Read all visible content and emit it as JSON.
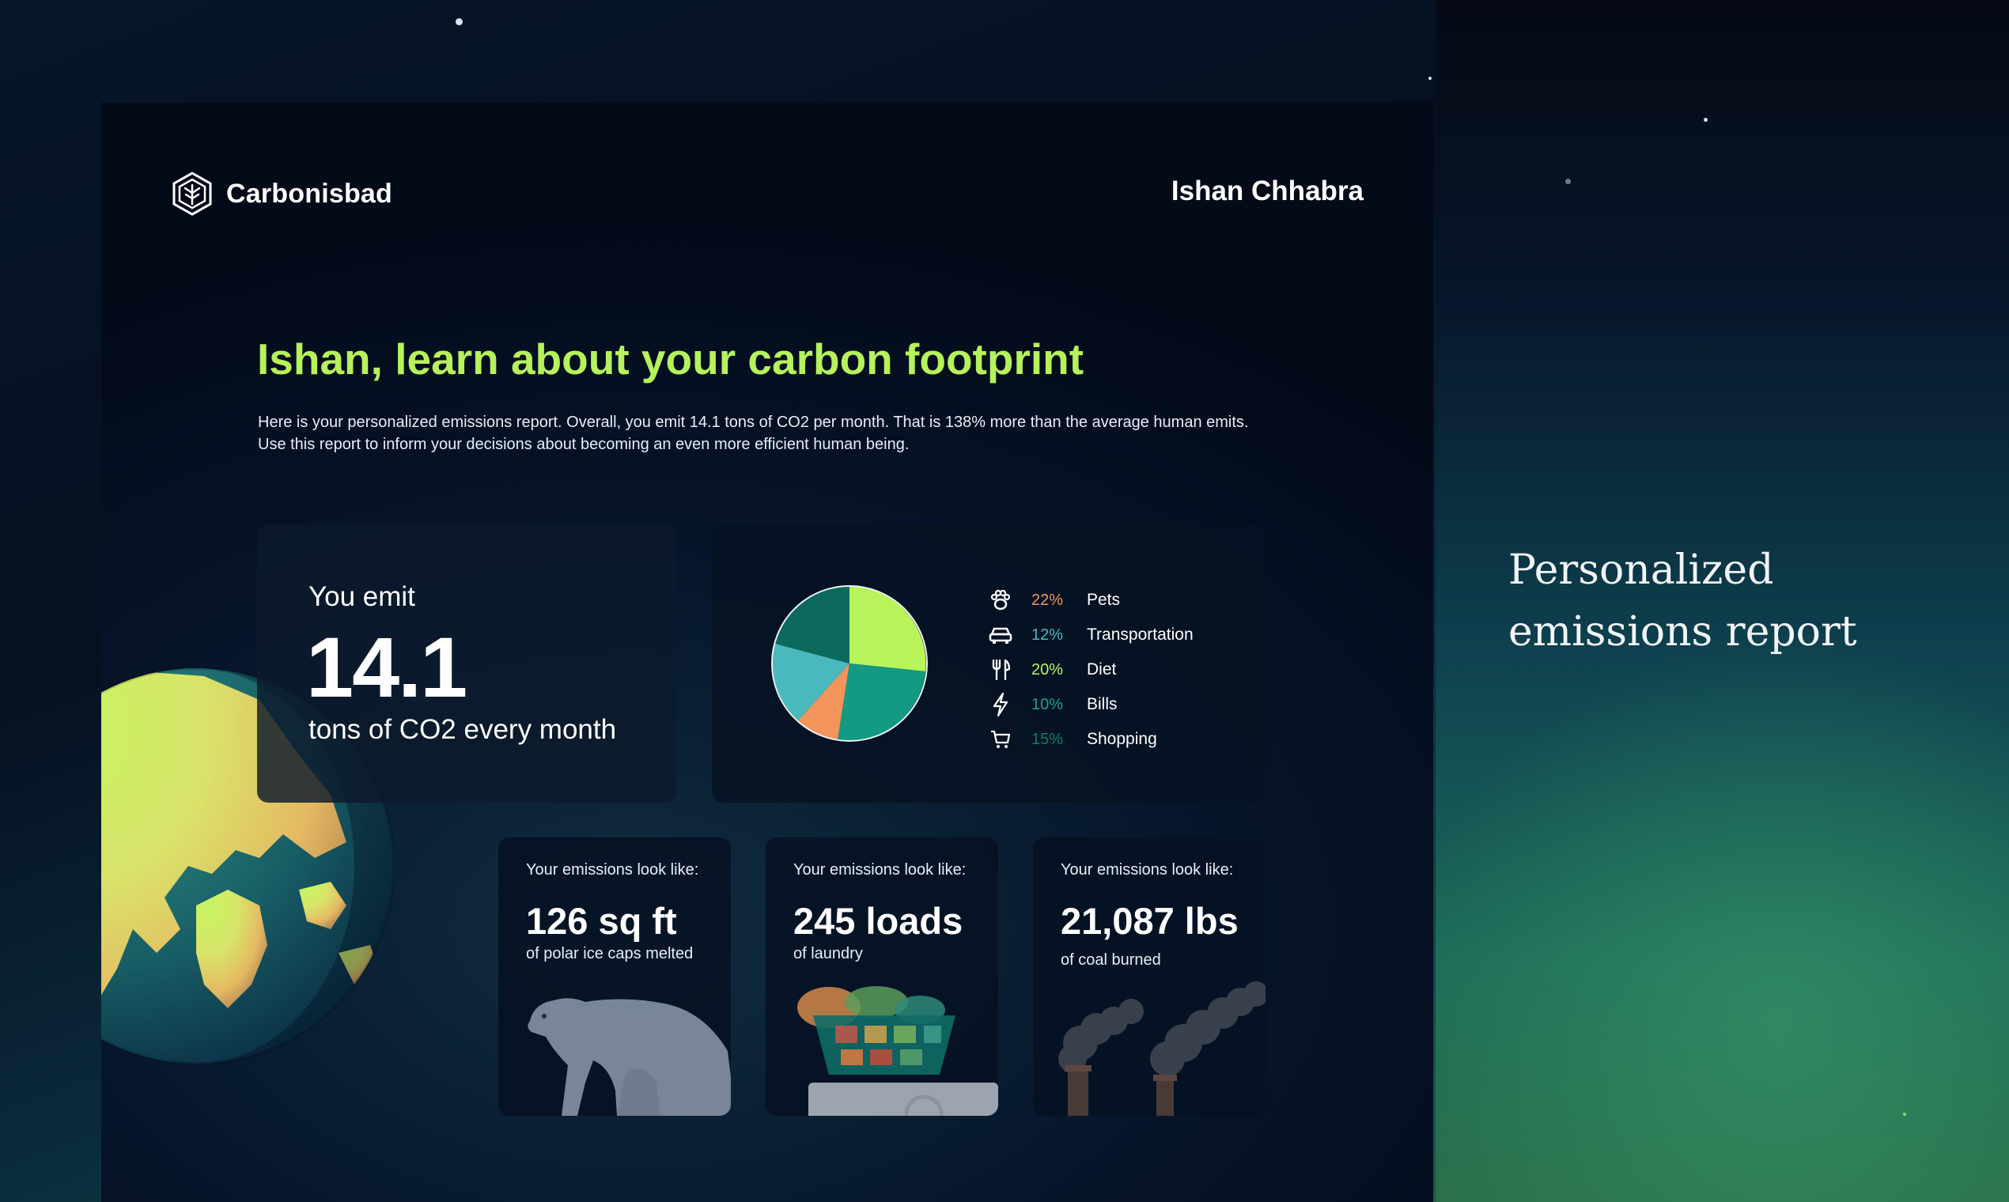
{
  "app": {
    "brand": "Carbonisbad",
    "user_name": "Ishan Chhabra"
  },
  "hero": {
    "headline": "Ishan, learn about your carbon footprint",
    "intro_line1": "Here is your personalized emissions report. Overall, you emit 14.1 tons of CO2 per month. That is 138% more than the average human emits.",
    "intro_line2": "Use this report to inform your decisions about becoming an even more efficient human being."
  },
  "emissions": {
    "label": "You emit",
    "value": "14.1",
    "unit_text": "tons of CO2 every month"
  },
  "breakdown": [
    {
      "icon": "paw-icon",
      "percent_text": "22%",
      "percent": 22,
      "label": "Pets",
      "color": "#f3955a"
    },
    {
      "icon": "car-icon",
      "percent_text": "12%",
      "percent": 12,
      "label": "Transportation",
      "color": "#4ab9bd"
    },
    {
      "icon": "fork-knife-icon",
      "percent_text": "20%",
      "percent": 20,
      "label": "Diet",
      "color": "#b8f45a"
    },
    {
      "icon": "lightning-icon",
      "percent_text": "10%",
      "percent": 10,
      "label": "Bills",
      "color": "#17a58a"
    },
    {
      "icon": "cart-icon",
      "percent_text": "15%",
      "percent": 15,
      "label": "Shopping",
      "color": "#0d7f6a"
    }
  ],
  "pie_colors": {
    "dark_teal": "#0b6a5c",
    "lime": "#b8f45a",
    "teal": "#129a83",
    "orange": "#f3955a",
    "cyan": "#4ab9bd"
  },
  "equivalents": [
    {
      "heading": "Your emissions look like:",
      "value": "126 sq ft",
      "sub": "of polar ice caps melted",
      "illustration": "polar-bear"
    },
    {
      "heading": "Your emissions look like:",
      "value": "245 loads",
      "sub": "of laundry",
      "illustration": "laundry-basket"
    },
    {
      "heading": "Your emissions look like:",
      "value": "21,087 lbs",
      "sub": "of coal burned",
      "illustration": "smokestacks"
    }
  ],
  "side": {
    "tagline_line1": "Personalized",
    "tagline_line2": "emissions report"
  }
}
